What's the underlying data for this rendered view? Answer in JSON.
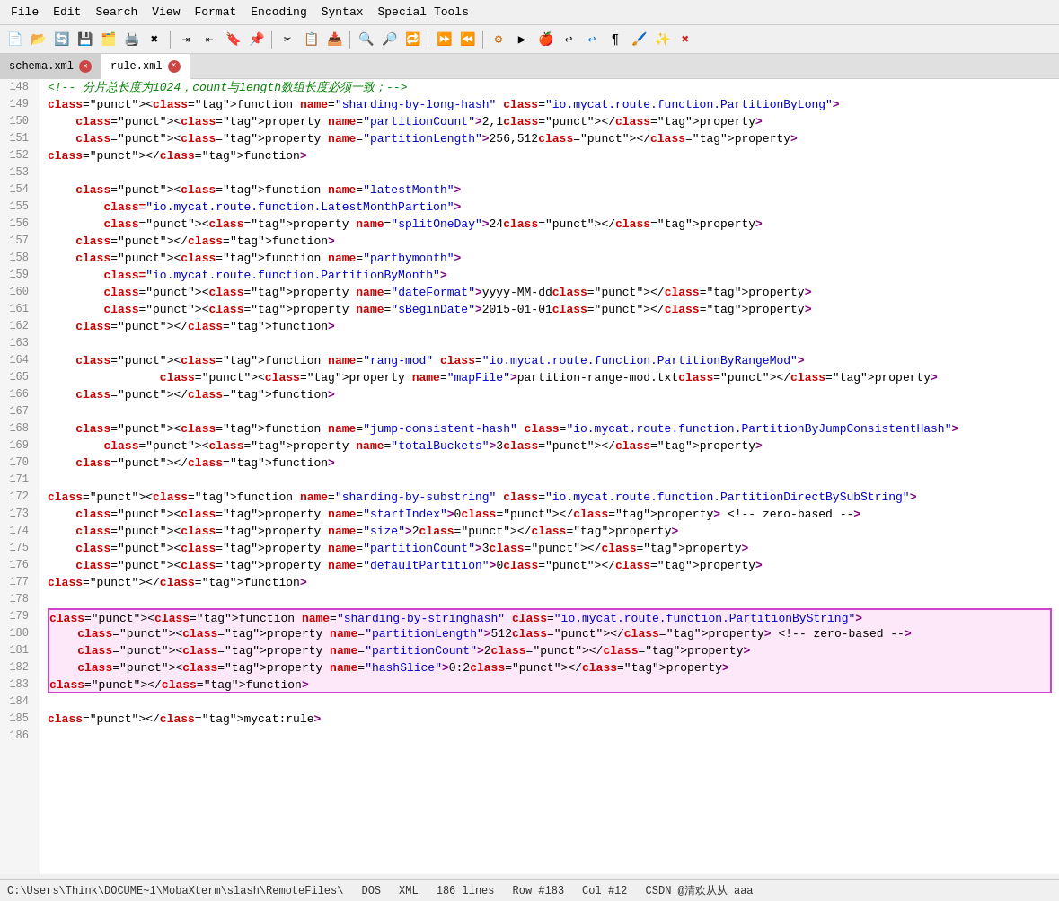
{
  "menubar": {
    "items": [
      "File",
      "Edit",
      "Search",
      "View",
      "Format",
      "Encoding",
      "Syntax",
      "Special Tools"
    ]
  },
  "tabs": [
    {
      "label": "schema.xml",
      "active": false
    },
    {
      "label": "rule.xml",
      "active": true
    }
  ],
  "statusbar": {
    "path": "C:\\Users\\Think\\DOCUME~1\\MobaXterm\\slash\\RemoteFiles\\",
    "dos": "DOS",
    "type": "XML",
    "lines": "186 lines",
    "row": "Row #183",
    "col": "Col #12",
    "watermark": "CSDN @清欢从从 aaa"
  },
  "code": {
    "lines": [
      {
        "num": 148,
        "content": "<!-- 分片总长度为1024，count与length数组长度必须一致；-->",
        "type": "comment-cn"
      },
      {
        "num": 149,
        "content": "<function name=\"sharding-by-long-hash\" class=\"io.mycat.route.function.PartitionByLong\">"
      },
      {
        "num": 150,
        "content": "    <property name=\"partitionCount\">2,1</property>"
      },
      {
        "num": 151,
        "content": "    <property name=\"partitionLength\">256,512</property>"
      },
      {
        "num": 152,
        "content": "</function>"
      },
      {
        "num": 153,
        "content": ""
      },
      {
        "num": 154,
        "content": "    <function name=\"latestMonth\">"
      },
      {
        "num": 155,
        "content": "        class=\"io.mycat.route.function.LatestMonthPartion\">"
      },
      {
        "num": 156,
        "content": "        <property name=\"splitOneDay\">24</property>"
      },
      {
        "num": 157,
        "content": "    </function>"
      },
      {
        "num": 158,
        "content": "    <function name=\"partbymonth\">"
      },
      {
        "num": 159,
        "content": "        class=\"io.mycat.route.function.PartitionByMonth\">"
      },
      {
        "num": 160,
        "content": "        <property name=\"dateFormat\">yyyy-MM-dd</property>"
      },
      {
        "num": 161,
        "content": "        <property name=\"sBeginDate\">2015-01-01</property>"
      },
      {
        "num": 162,
        "content": "    </function>"
      },
      {
        "num": 163,
        "content": ""
      },
      {
        "num": 164,
        "content": "    <function name=\"rang-mod\" class=\"io.mycat.route.function.PartitionByRangeMod\">"
      },
      {
        "num": 165,
        "content": "                <property name=\"mapFile\">partition-range-mod.txt</property>"
      },
      {
        "num": 166,
        "content": "    </function>"
      },
      {
        "num": 167,
        "content": ""
      },
      {
        "num": 168,
        "content": "    <function name=\"jump-consistent-hash\" class=\"io.mycat.route.function.PartitionByJumpConsistentHash\">"
      },
      {
        "num": 169,
        "content": "        <property name=\"totalBuckets\">3</property>"
      },
      {
        "num": 170,
        "content": "    </function>"
      },
      {
        "num": 171,
        "content": ""
      },
      {
        "num": 172,
        "content": "<function name=\"sharding-by-substring\" class=\"io.mycat.route.function.PartitionDirectBySubString\">"
      },
      {
        "num": 173,
        "content": "    <property name=\"startIndex\">0</property> <!-- zero-based -->"
      },
      {
        "num": 174,
        "content": "    <property name=\"size\">2</property>"
      },
      {
        "num": 175,
        "content": "    <property name=\"partitionCount\">3</property>"
      },
      {
        "num": 176,
        "content": "    <property name=\"defaultPartition\">0</property>"
      },
      {
        "num": 177,
        "content": "</function>"
      },
      {
        "num": 178,
        "content": ""
      },
      {
        "num": 179,
        "content": "<function name=\"sharding-by-stringhash\" class=\"io.mycat.route.function.PartitionByString\">",
        "highlight": "top"
      },
      {
        "num": 180,
        "content": "    <property name=\"partitionLength\">512</property> <!-- zero-based -->",
        "highlight": "mid"
      },
      {
        "num": 181,
        "content": "    <property name=\"partitionCount\">2</property>",
        "highlight": "mid"
      },
      {
        "num": 182,
        "content": "    <property name=\"hashSlice\">0:2</property>",
        "highlight": "mid"
      },
      {
        "num": 183,
        "content": "</function>",
        "highlight": "bottom"
      },
      {
        "num": 184,
        "content": ""
      },
      {
        "num": 185,
        "content": "</mycat:rule>"
      },
      {
        "num": 186,
        "content": ""
      }
    ]
  }
}
